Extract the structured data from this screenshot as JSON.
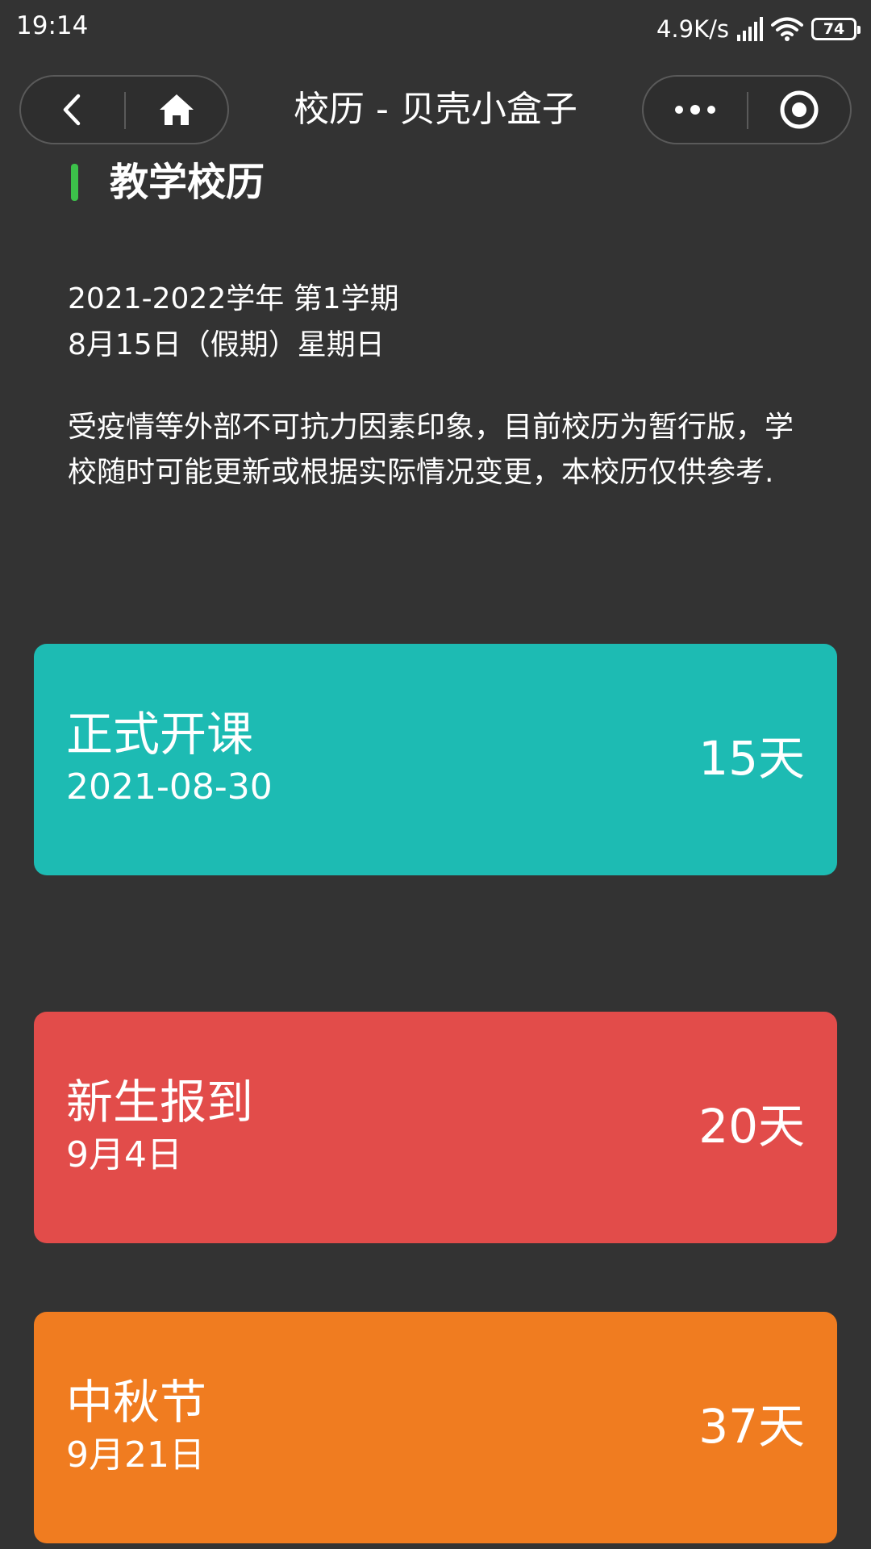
{
  "status_bar": {
    "time": "19:14",
    "net_speed": "4.9K/s",
    "battery_level": "74",
    "icons": [
      "signal-icon",
      "wifi-icon",
      "battery-icon"
    ]
  },
  "nav": {
    "title": "校历 - 贝壳小盒子",
    "icons": [
      "back-icon",
      "home-icon",
      "more-icon",
      "target-icon"
    ]
  },
  "section": {
    "title": "教学校历",
    "accent_color": "#3cc14a"
  },
  "term": {
    "label": "2021-2022学年 第1学期",
    "today": "8月15日（假期）星期日"
  },
  "notice": "受疫情等外部不可抗力因素印象，目前校历为暂行版，学校随时可能更新或根据实际情况变更，本校历仅供参考.",
  "events": [
    {
      "name": "正式开课",
      "date": "2021-08-30",
      "days": "15天",
      "color": "#1dbbb3"
    },
    {
      "name": "新生报到",
      "date": "9月4日",
      "days": "20天",
      "color": "#e24c4a"
    },
    {
      "name": "中秋节",
      "date": "9月21日",
      "days": "37天",
      "color": "#f07c20"
    }
  ],
  "colors": {
    "background": "#333333",
    "text": "#ffffff"
  }
}
